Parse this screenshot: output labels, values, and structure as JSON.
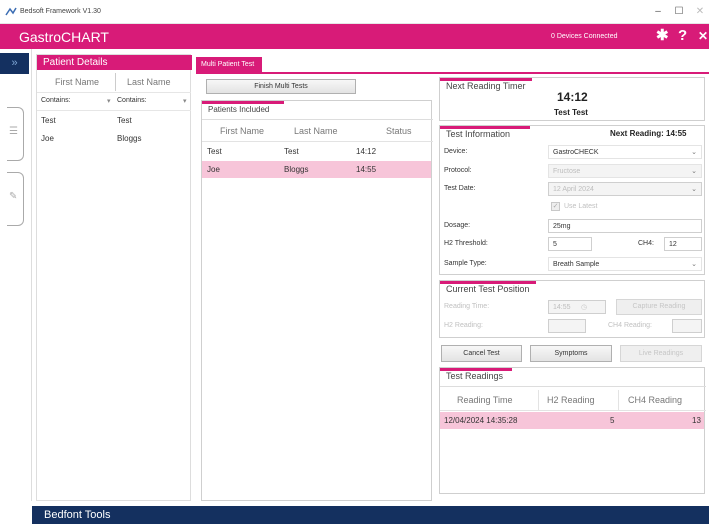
{
  "window": {
    "title": "Bedsoft Framework V1.30",
    "minimize": "–",
    "maximize": "☐"
  },
  "header": {
    "brand": "GastroCHART",
    "devices_status": "0 Devices Connected",
    "settings_icon": "✱",
    "help_icon": "?",
    "close_icon": "✕"
  },
  "sidebar": {
    "collapse_icon": "»",
    "tab1_icon": "☰",
    "tab2_icon": "✎"
  },
  "patient_details": {
    "title": "Patient Details",
    "columns": [
      "First Name",
      "Last Name"
    ],
    "filters": [
      "Contains:",
      "Contains:"
    ],
    "rows": [
      {
        "first": "Test",
        "last": "Test"
      },
      {
        "first": "Joe",
        "last": "Bloggs"
      }
    ]
  },
  "tab": {
    "label": "Multi Patient Test"
  },
  "finish_button": "Finish Multi Tests",
  "patients_included": {
    "title": "Patients Included",
    "columns": [
      "First Name",
      "Last Name",
      "Status"
    ],
    "rows": [
      {
        "first": "Test",
        "last": "Test",
        "status": "14:12"
      },
      {
        "first": "Joe",
        "last": "Bloggs",
        "status": "14:55"
      }
    ]
  },
  "timer": {
    "title": "Next Reading Timer",
    "time": "14:12",
    "name": "Test Test"
  },
  "test_info": {
    "title": "Test Information",
    "next_reading": "Next Reading: 14:55",
    "device_label": "Device:",
    "device_value": "GastroCHECK",
    "protocol_label": "Protocol:",
    "protocol_value": "Fructose",
    "date_label": "Test Date:",
    "date_value": "12 April 2024",
    "use_latest": "Use Latest",
    "dosage_label": "Dosage:",
    "dosage_value": "25mg",
    "h2_label": "H2 Threshold:",
    "h2_value": "5",
    "ch4_label": "CH4:",
    "ch4_value": "12",
    "sample_label": "Sample Type:",
    "sample_value": "Breath Sample"
  },
  "current_position": {
    "title": "Current Test Position",
    "reading_time_label": "Reading Time:",
    "reading_time_value": "14:55",
    "capture_button": "Capture Reading",
    "h2_reading_label": "H2 Reading:",
    "ch4_reading_label": "CH4 Reading:"
  },
  "actions": {
    "cancel": "Cancel Test",
    "symptoms": "Symptoms",
    "live": "Live Readings"
  },
  "test_readings": {
    "title": "Test Readings",
    "columns": [
      "Reading Time",
      "H2 Reading",
      "CH4 Reading"
    ],
    "rows": [
      {
        "time": "12/04/2024 14:35:28",
        "h2": "5",
        "ch4": "13"
      }
    ]
  },
  "footer": {
    "title": "Bedfont Tools"
  },
  "colors": {
    "brand": "#d81b78",
    "navy": "#14305f",
    "selection": "#f7c5d9"
  }
}
